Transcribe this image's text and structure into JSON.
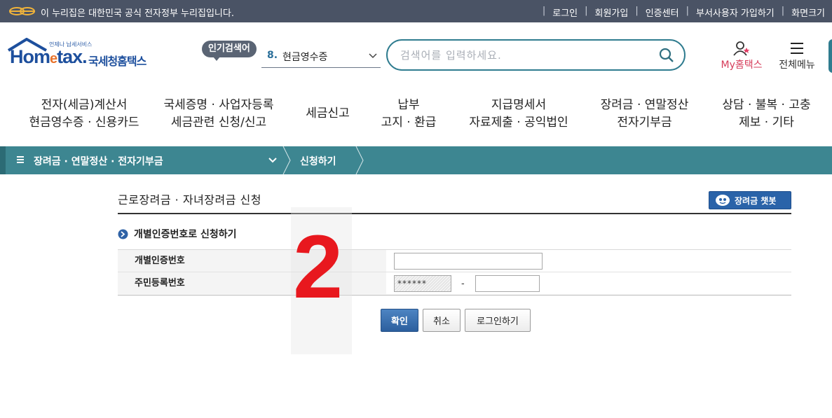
{
  "gov_bar": {
    "text": "이 누리집은 대한민국 공식 전자정부 누리집입니다.",
    "links": [
      "로그인",
      "회원가입",
      "인증센터",
      "부서사용자 가입하기",
      "화면크기"
    ]
  },
  "header": {
    "logo_small": "언제나 납세서비스",
    "logo_word_prefix": "Hom",
    "logo_word_e": "e",
    "logo_word_suffix": "tax.",
    "logo_kr": "국세청홈택스",
    "popular_badge": "인기검색어",
    "popular_num": "8.",
    "popular_value": "현금영수증",
    "search_placeholder": "검색어를 입력하세요.",
    "my_home": "My홈택스",
    "all_menu": "전체메뉴"
  },
  "gnb": [
    {
      "line1": "전자(세금)계산서",
      "line2": "현금영수증 · 신용카드"
    },
    {
      "line1": "국세증명 · 사업자등록",
      "line2": "세금관련 신청/신고"
    },
    {
      "line1": "세금신고",
      "line2": ""
    },
    {
      "line1": "납부",
      "line2": "고지 · 환급"
    },
    {
      "line1": "지급명세서",
      "line2": "자료제출 · 공익법인"
    },
    {
      "line1": "장려금 · 연말정산",
      "line2": "전자기부금"
    },
    {
      "line1": "상담 · 불복 · 고충",
      "line2": "제보 · 기타"
    }
  ],
  "path": {
    "section": "장려금 · 연말정산 · 전자기부금",
    "current": "신청하기"
  },
  "content": {
    "title": "근로장려금 · 자녀장려금 신청",
    "chatbot": "장려금 챗봇",
    "subtitle": "개별인증번호로 신청하기",
    "rows": [
      {
        "label": "개별인증번호",
        "value": ""
      },
      {
        "label": "주민등록번호",
        "masked": "******",
        "dash": "-",
        "value": ""
      }
    ],
    "buttons": {
      "confirm": "확인",
      "cancel": "취소",
      "login": "로그인하기"
    }
  },
  "overlay_step": "2",
  "colors": {
    "gov_bar": "#4a5365",
    "teal": "#3d8691",
    "search_border": "#2f7c8f",
    "brand_blue": "#1d4f9d",
    "step_red": "#e8181e"
  }
}
